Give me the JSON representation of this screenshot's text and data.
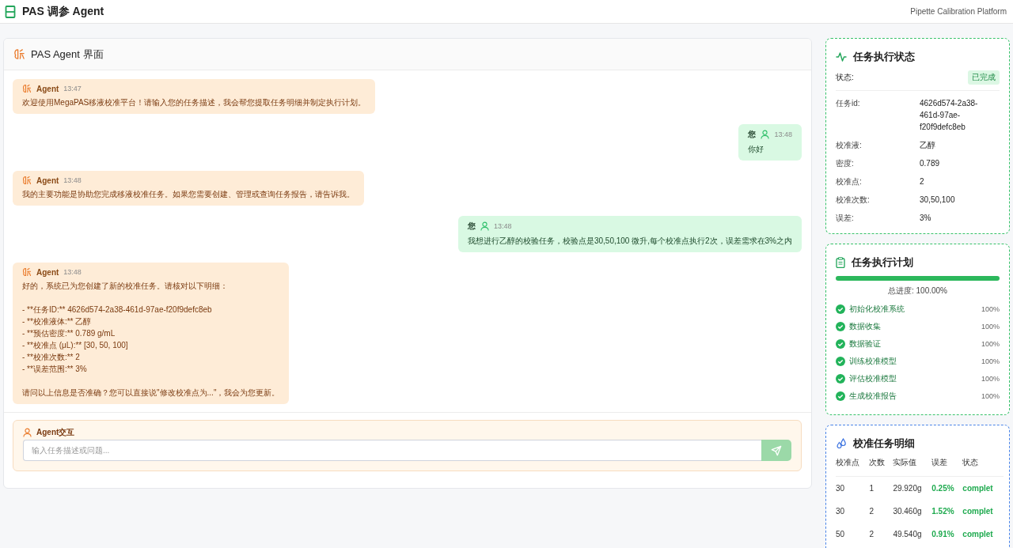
{
  "header": {
    "title": "PAS 调参 Agent",
    "subtitle": "Pipette Calibration Platform"
  },
  "chat": {
    "title": "PAS Agent 界面",
    "messages": [
      {
        "kind": "agent",
        "sender": "Agent",
        "time": "13:47",
        "text": "欢迎使用MegaPAS移液校准平台！请输入您的任务描述，我会帮您提取任务明细并制定执行计划。"
      },
      {
        "kind": "user",
        "sender": "您",
        "time": "13:48",
        "text": "你好"
      },
      {
        "kind": "agent",
        "sender": "Agent",
        "time": "13:48",
        "text": "我的主要功能是协助您完成移液校准任务。如果您需要创建、管理或查询任务报告，请告诉我。"
      },
      {
        "kind": "user",
        "sender": "您",
        "time": "13:48",
        "text": "我想进行乙醇的校验任务，校验点是30,50,100 微升,每个校准点执行2次，误差需求在3%之内"
      },
      {
        "kind": "agent",
        "sender": "Agent",
        "time": "13:48",
        "text": "好的，系统已为您创建了新的校准任务。请核对以下明细：\n\n- **任务ID:** 4626d574-2a38-461d-97ae-f20f9defc8eb\n- **校准液体:** 乙醇\n- **预估密度:** 0.789 g/mL\n- **校准点 (μL):** [30, 50, 100]\n- **校准次数:** 2\n- **误差范围:** 3%\n\n请问以上信息是否准确？您可以直接说\"修改校准点为...\"，我会为您更新。"
      }
    ],
    "input": {
      "label": "Agent交互",
      "placeholder": "输入任务描述或问题..."
    }
  },
  "status_panel": {
    "title": "任务执行状态",
    "status_label": "状态:",
    "status": "已完成",
    "fields": [
      {
        "label": "任务id:",
        "value": "4626d574-2a38-461d-97ae-f20f9defc8eb"
      },
      {
        "label": "校准液:",
        "value": "乙醇"
      },
      {
        "label": "密度:",
        "value": "0.789"
      },
      {
        "label": "校准点:",
        "value": "2"
      },
      {
        "label": "校准次数:",
        "value": "30,50,100"
      },
      {
        "label": "误差:",
        "value": "3%"
      }
    ]
  },
  "plan_panel": {
    "title": "任务执行计划",
    "level": 1,
    "total": "总进度: 100.00%",
    "steps": [
      {
        "name": "初始化校准系统",
        "percent": "100%",
        "done": true
      },
      {
        "name": "数据收集",
        "percent": "100%",
        "done": true
      },
      {
        "name": "数据验证",
        "percent": "100%",
        "done": true
      },
      {
        "name": "训练校准模型",
        "percent": "100%",
        "done": true
      },
      {
        "name": "评估校准模型",
        "percent": "100%",
        "done": true
      },
      {
        "name": "生成校准报告",
        "percent": "100%",
        "done": true
      }
    ]
  },
  "detail_panel": {
    "title": "校准任务明细",
    "columns": [
      "校准点",
      "次数",
      "实际值",
      "误差",
      "状态"
    ],
    "rows": [
      [
        "30",
        "1",
        "29.920g",
        "0.25%",
        "complet"
      ],
      [
        "30",
        "2",
        "30.460g",
        "1.52%",
        "complet"
      ],
      [
        "50",
        "2",
        "49.540g",
        "0.91%",
        "complet"
      ]
    ]
  }
}
